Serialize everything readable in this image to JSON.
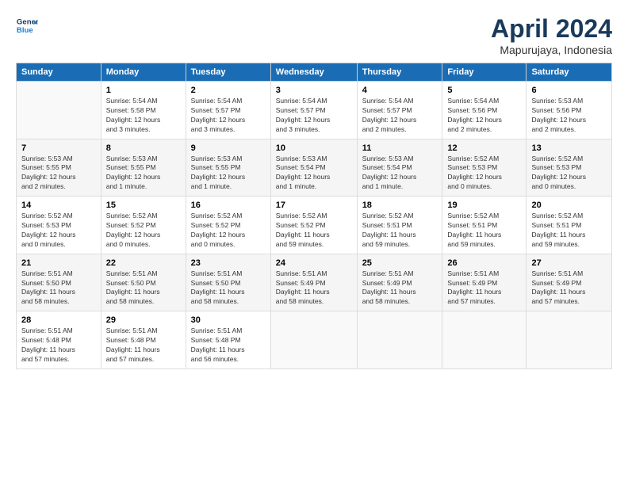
{
  "header": {
    "logo_line1": "General",
    "logo_line2": "Blue",
    "title": "April 2024",
    "subtitle": "Mapurujaya, Indonesia"
  },
  "columns": [
    "Sunday",
    "Monday",
    "Tuesday",
    "Wednesday",
    "Thursday",
    "Friday",
    "Saturday"
  ],
  "weeks": [
    [
      {
        "day": "",
        "info": ""
      },
      {
        "day": "1",
        "info": "Sunrise: 5:54 AM\nSunset: 5:58 PM\nDaylight: 12 hours\nand 3 minutes."
      },
      {
        "day": "2",
        "info": "Sunrise: 5:54 AM\nSunset: 5:57 PM\nDaylight: 12 hours\nand 3 minutes."
      },
      {
        "day": "3",
        "info": "Sunrise: 5:54 AM\nSunset: 5:57 PM\nDaylight: 12 hours\nand 3 minutes."
      },
      {
        "day": "4",
        "info": "Sunrise: 5:54 AM\nSunset: 5:57 PM\nDaylight: 12 hours\nand 2 minutes."
      },
      {
        "day": "5",
        "info": "Sunrise: 5:54 AM\nSunset: 5:56 PM\nDaylight: 12 hours\nand 2 minutes."
      },
      {
        "day": "6",
        "info": "Sunrise: 5:53 AM\nSunset: 5:56 PM\nDaylight: 12 hours\nand 2 minutes."
      }
    ],
    [
      {
        "day": "7",
        "info": "Sunrise: 5:53 AM\nSunset: 5:55 PM\nDaylight: 12 hours\nand 2 minutes."
      },
      {
        "day": "8",
        "info": "Sunrise: 5:53 AM\nSunset: 5:55 PM\nDaylight: 12 hours\nand 1 minute."
      },
      {
        "day": "9",
        "info": "Sunrise: 5:53 AM\nSunset: 5:55 PM\nDaylight: 12 hours\nand 1 minute."
      },
      {
        "day": "10",
        "info": "Sunrise: 5:53 AM\nSunset: 5:54 PM\nDaylight: 12 hours\nand 1 minute."
      },
      {
        "day": "11",
        "info": "Sunrise: 5:53 AM\nSunset: 5:54 PM\nDaylight: 12 hours\nand 1 minute."
      },
      {
        "day": "12",
        "info": "Sunrise: 5:52 AM\nSunset: 5:53 PM\nDaylight: 12 hours\nand 0 minutes."
      },
      {
        "day": "13",
        "info": "Sunrise: 5:52 AM\nSunset: 5:53 PM\nDaylight: 12 hours\nand 0 minutes."
      }
    ],
    [
      {
        "day": "14",
        "info": "Sunrise: 5:52 AM\nSunset: 5:53 PM\nDaylight: 12 hours\nand 0 minutes."
      },
      {
        "day": "15",
        "info": "Sunrise: 5:52 AM\nSunset: 5:52 PM\nDaylight: 12 hours\nand 0 minutes."
      },
      {
        "day": "16",
        "info": "Sunrise: 5:52 AM\nSunset: 5:52 PM\nDaylight: 12 hours\nand 0 minutes."
      },
      {
        "day": "17",
        "info": "Sunrise: 5:52 AM\nSunset: 5:52 PM\nDaylight: 11 hours\nand 59 minutes."
      },
      {
        "day": "18",
        "info": "Sunrise: 5:52 AM\nSunset: 5:51 PM\nDaylight: 11 hours\nand 59 minutes."
      },
      {
        "day": "19",
        "info": "Sunrise: 5:52 AM\nSunset: 5:51 PM\nDaylight: 11 hours\nand 59 minutes."
      },
      {
        "day": "20",
        "info": "Sunrise: 5:52 AM\nSunset: 5:51 PM\nDaylight: 11 hours\nand 59 minutes."
      }
    ],
    [
      {
        "day": "21",
        "info": "Sunrise: 5:51 AM\nSunset: 5:50 PM\nDaylight: 11 hours\nand 58 minutes."
      },
      {
        "day": "22",
        "info": "Sunrise: 5:51 AM\nSunset: 5:50 PM\nDaylight: 11 hours\nand 58 minutes."
      },
      {
        "day": "23",
        "info": "Sunrise: 5:51 AM\nSunset: 5:50 PM\nDaylight: 11 hours\nand 58 minutes."
      },
      {
        "day": "24",
        "info": "Sunrise: 5:51 AM\nSunset: 5:49 PM\nDaylight: 11 hours\nand 58 minutes."
      },
      {
        "day": "25",
        "info": "Sunrise: 5:51 AM\nSunset: 5:49 PM\nDaylight: 11 hours\nand 58 minutes."
      },
      {
        "day": "26",
        "info": "Sunrise: 5:51 AM\nSunset: 5:49 PM\nDaylight: 11 hours\nand 57 minutes."
      },
      {
        "day": "27",
        "info": "Sunrise: 5:51 AM\nSunset: 5:49 PM\nDaylight: 11 hours\nand 57 minutes."
      }
    ],
    [
      {
        "day": "28",
        "info": "Sunrise: 5:51 AM\nSunset: 5:48 PM\nDaylight: 11 hours\nand 57 minutes."
      },
      {
        "day": "29",
        "info": "Sunrise: 5:51 AM\nSunset: 5:48 PM\nDaylight: 11 hours\nand 57 minutes."
      },
      {
        "day": "30",
        "info": "Sunrise: 5:51 AM\nSunset: 5:48 PM\nDaylight: 11 hours\nand 56 minutes."
      },
      {
        "day": "",
        "info": ""
      },
      {
        "day": "",
        "info": ""
      },
      {
        "day": "",
        "info": ""
      },
      {
        "day": "",
        "info": ""
      }
    ]
  ]
}
